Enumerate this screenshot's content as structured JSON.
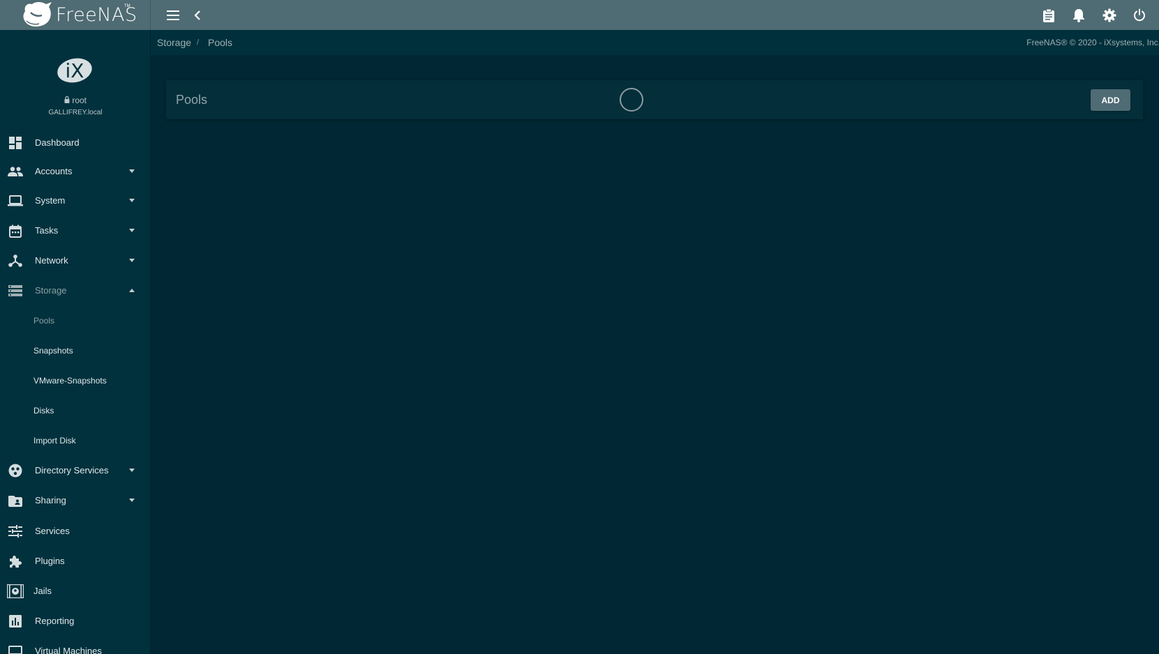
{
  "app": {
    "logo_text": "FreeNAS",
    "logo_tm": "TM"
  },
  "topbar": {
    "menu_icon": "menu-icon",
    "back_icon": "chevron-left-icon",
    "actions": [
      {
        "name": "task-manager-button",
        "icon": "clipboard-icon"
      },
      {
        "name": "notifications-button",
        "icon": "bell-icon"
      },
      {
        "name": "settings-button",
        "icon": "gear-icon"
      },
      {
        "name": "power-button",
        "icon": "power-icon"
      }
    ]
  },
  "user": {
    "avatar_text": "iX",
    "username": "root",
    "hostname": "GALLIFREY.local"
  },
  "sidebar": {
    "items": [
      {
        "label": "Dashboard",
        "icon": "dashboard-icon",
        "expandable": false
      },
      {
        "label": "Accounts",
        "icon": "people-icon",
        "expandable": true
      },
      {
        "label": "System",
        "icon": "laptop-icon",
        "expandable": true
      },
      {
        "label": "Tasks",
        "icon": "calendar-icon",
        "expandable": true
      },
      {
        "label": "Network",
        "icon": "network-icon",
        "expandable": true
      },
      {
        "label": "Storage",
        "icon": "storage-icon",
        "expandable": true,
        "expanded": true
      },
      {
        "label": "Pools",
        "sub": true,
        "active": true
      },
      {
        "label": "Snapshots",
        "sub": true
      },
      {
        "label": "VMware-Snapshots",
        "sub": true
      },
      {
        "label": "Disks",
        "sub": true
      },
      {
        "label": "Import Disk",
        "sub": true
      },
      {
        "label": "Directory Services",
        "icon": "directory-icon",
        "expandable": true
      },
      {
        "label": "Sharing",
        "icon": "shared-folder-icon",
        "expandable": true
      },
      {
        "label": "Services",
        "icon": "tune-icon",
        "expandable": false
      },
      {
        "label": "Plugins",
        "icon": "puzzle-icon",
        "expandable": false
      },
      {
        "label": "Jails",
        "icon": "jail-icon",
        "expandable": false
      },
      {
        "label": "Reporting",
        "icon": "chart-icon",
        "expandable": false
      },
      {
        "label": "Virtual Machines",
        "icon": "computer-icon",
        "expandable": false
      }
    ]
  },
  "breadcrumb": {
    "items": [
      "Storage",
      "Pools"
    ],
    "separator": "/"
  },
  "copyright": "FreeNAS® © 2020 - iXsystems, Inc.",
  "pools_card": {
    "title": "Pools",
    "add_label": "ADD",
    "loading": true
  },
  "colors": {
    "topbar": "#4f6b73",
    "sidebar": "#00313d",
    "content_bg": "#002733",
    "card": "#032e3a",
    "button": "#4f6b73"
  }
}
